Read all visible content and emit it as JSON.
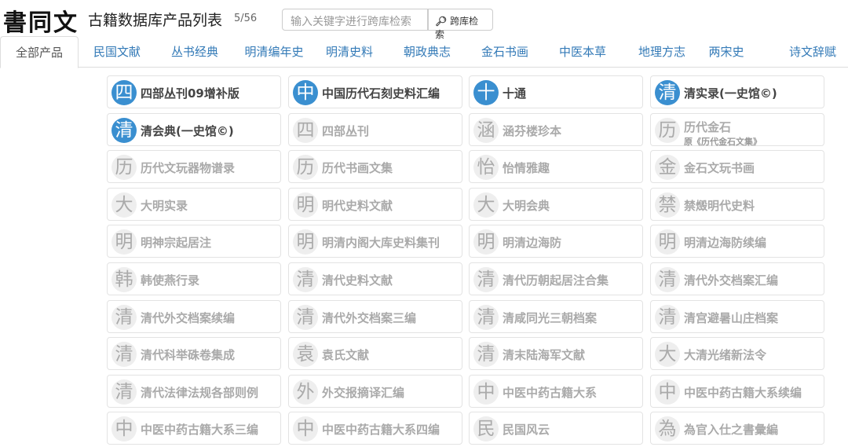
{
  "header": {
    "logo": "書同文",
    "title": "古籍数据库产品列表",
    "count": "5/56",
    "search_placeholder": "输入关键字进行跨库检索",
    "search_button": "跨库检索"
  },
  "tabs": [
    "全部产品",
    "民国文献",
    "丛书经典",
    "明清编年史",
    "明清史料",
    "朝政典志",
    "金石书画",
    "中医本草",
    "地理方志",
    "两宋史",
    "诗文辞赋"
  ],
  "products": [
    {
      "icon": "四",
      "name": "四部丛刊09增补版",
      "active": true
    },
    {
      "icon": "中",
      "name": "中国历代石刻史料汇编",
      "active": true
    },
    {
      "icon": "十",
      "name": "十通",
      "active": true
    },
    {
      "icon": "清",
      "name": "清实录(一史馆©)",
      "active": true
    },
    {
      "icon": "清",
      "name": "清会典(一史馆©)",
      "active": true
    },
    {
      "icon": "四",
      "name": "四部丛刊",
      "active": false
    },
    {
      "icon": "涵",
      "name": "涵芬楼珍本",
      "active": false
    },
    {
      "icon": "历",
      "name": "历代金石",
      "sub": "原《历代金石文集》",
      "active": false
    },
    {
      "icon": "历",
      "name": "历代文玩器物谱录",
      "active": false
    },
    {
      "icon": "历",
      "name": "历代书画文集",
      "active": false
    },
    {
      "icon": "怡",
      "name": "怡情雅趣",
      "active": false
    },
    {
      "icon": "金",
      "name": "金石文玩书画",
      "active": false
    },
    {
      "icon": "大",
      "name": "大明实录",
      "active": false
    },
    {
      "icon": "明",
      "name": "明代史料文献",
      "active": false
    },
    {
      "icon": "大",
      "name": "大明会典",
      "active": false
    },
    {
      "icon": "禁",
      "name": "禁燬明代史料",
      "active": false
    },
    {
      "icon": "明",
      "name": "明神宗起居注",
      "active": false
    },
    {
      "icon": "明",
      "name": "明清内阁大库史料集刊",
      "active": false
    },
    {
      "icon": "明",
      "name": "明清边海防",
      "active": false
    },
    {
      "icon": "明",
      "name": "明清边海防续编",
      "active": false
    },
    {
      "icon": "韩",
      "name": "韩使燕行录",
      "active": false
    },
    {
      "icon": "清",
      "name": "清代史料文献",
      "active": false
    },
    {
      "icon": "清",
      "name": "清代历朝起居注合集",
      "active": false
    },
    {
      "icon": "清",
      "name": "清代外交档案汇编",
      "active": false
    },
    {
      "icon": "清",
      "name": "清代外交档案续编",
      "active": false
    },
    {
      "icon": "清",
      "name": "清代外交档案三编",
      "active": false
    },
    {
      "icon": "清",
      "name": "清咸同光三朝档案",
      "active": false
    },
    {
      "icon": "清",
      "name": "清宫避暑山庄档案",
      "active": false
    },
    {
      "icon": "清",
      "name": "清代科举硃卷集成",
      "active": false
    },
    {
      "icon": "袁",
      "name": "袁氏文献",
      "active": false
    },
    {
      "icon": "清",
      "name": "清末陆海军文献",
      "active": false
    },
    {
      "icon": "大",
      "name": "大清光绪新法令",
      "active": false
    },
    {
      "icon": "清",
      "name": "清代法律法规各部则例",
      "active": false
    },
    {
      "icon": "外",
      "name": "外交报摘译汇编",
      "active": false
    },
    {
      "icon": "中",
      "name": "中医中药古籍大系",
      "active": false
    },
    {
      "icon": "中",
      "name": "中医中药古籍大系续编",
      "active": false
    },
    {
      "icon": "中",
      "name": "中医中药古籍大系三编",
      "active": false
    },
    {
      "icon": "中",
      "name": "中医中药古籍大系四编",
      "active": false
    },
    {
      "icon": "民",
      "name": "民国风云",
      "active": false
    },
    {
      "icon": "為",
      "name": "為官入仕之書彙編",
      "active": false
    }
  ]
}
